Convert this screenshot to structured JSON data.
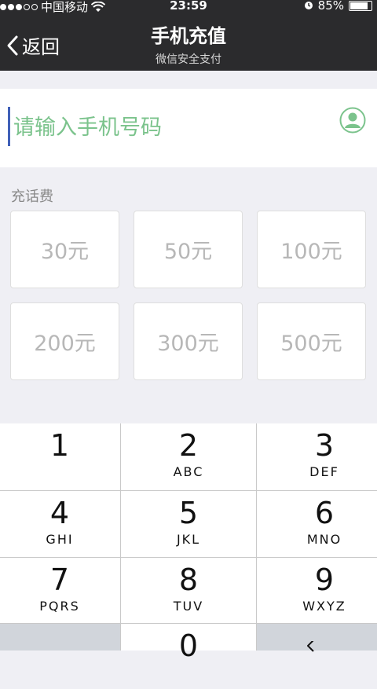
{
  "status": {
    "carrier": "中国移动",
    "time": "23:59",
    "battery": "85%"
  },
  "nav": {
    "back_label": "返回",
    "title": "手机充值",
    "subtitle": "微信安全支付"
  },
  "phone_input": {
    "placeholder": "请输入手机号码"
  },
  "recharge": {
    "label": "充话费",
    "amounts": [
      "30元",
      "50元",
      "100元",
      "200元",
      "300元",
      "500元"
    ]
  },
  "keypad": [
    {
      "num": "1",
      "letters": ""
    },
    {
      "num": "2",
      "letters": "ABC"
    },
    {
      "num": "3",
      "letters": "DEF"
    },
    {
      "num": "4",
      "letters": "GHI"
    },
    {
      "num": "5",
      "letters": "JKL"
    },
    {
      "num": "6",
      "letters": "MNO"
    },
    {
      "num": "7",
      "letters": "PQRS"
    },
    {
      "num": "8",
      "letters": "TUV"
    },
    {
      "num": "9",
      "letters": "WXYZ"
    },
    {
      "num": "0",
      "letters": ""
    }
  ],
  "colors": {
    "accent_green": "#7bc38c",
    "nav_bg": "#2b2b2d"
  }
}
